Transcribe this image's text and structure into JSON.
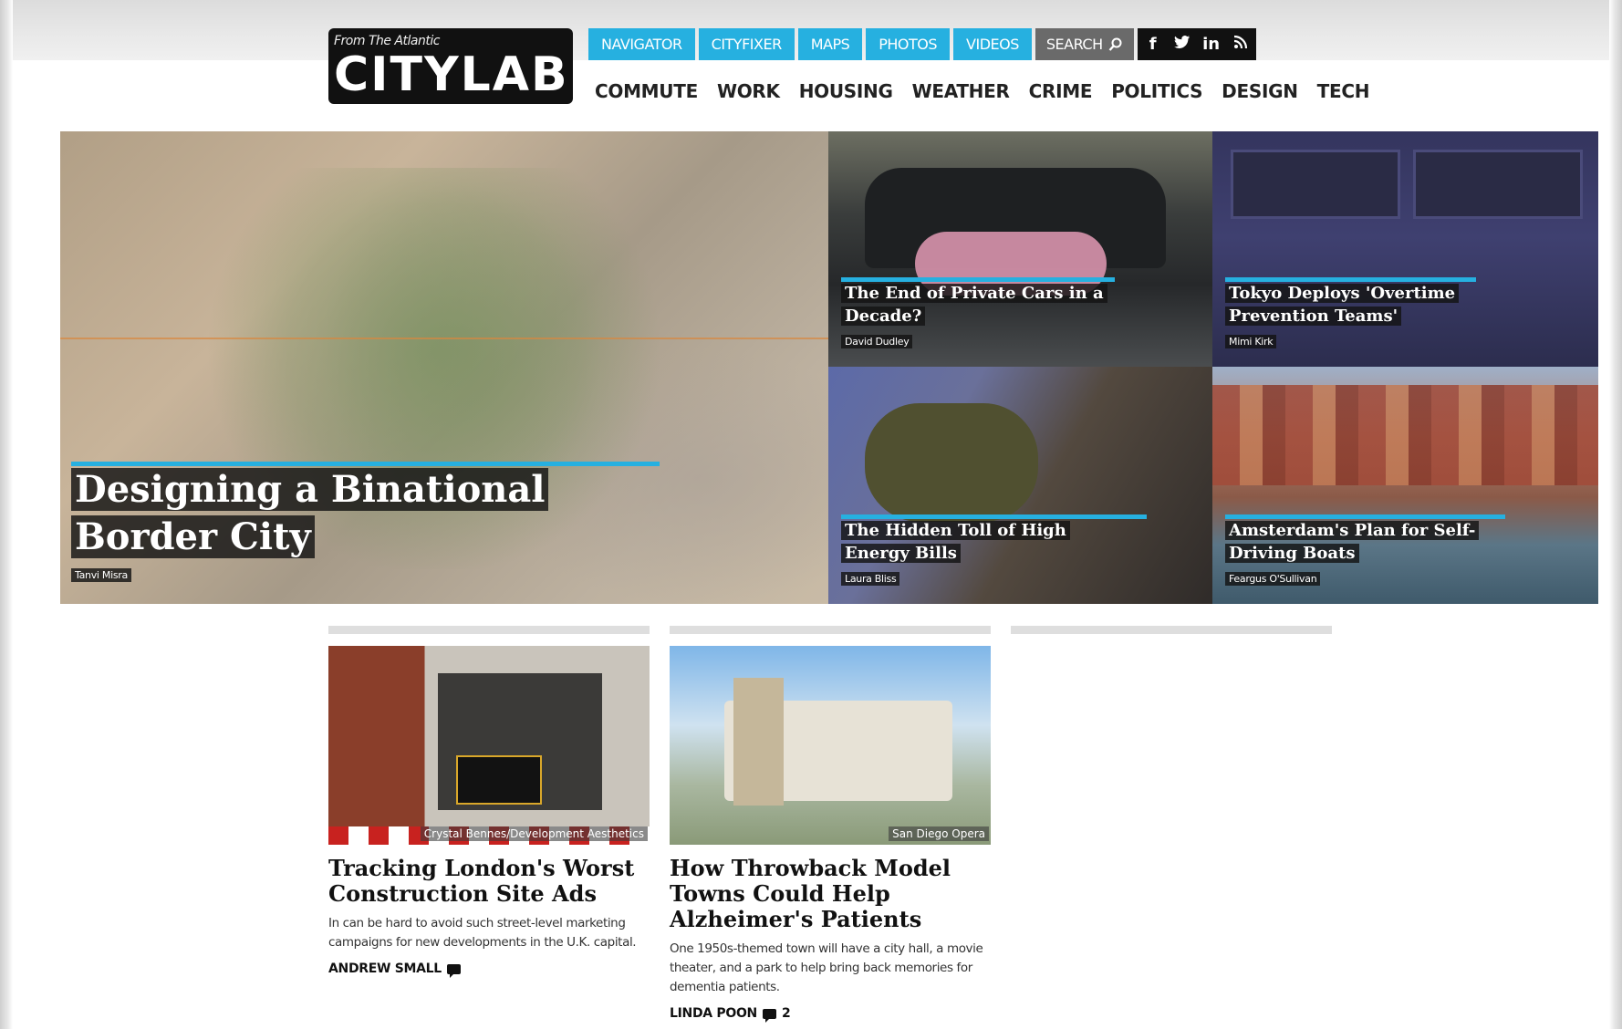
{
  "brand": {
    "from_label": "From The Atlantic",
    "name": "CITYLAB"
  },
  "top_nav": {
    "tabs": [
      "NAVIGATOR",
      "CITYFIXER",
      "MAPS",
      "PHOTOS",
      "VIDEOS"
    ],
    "search_label": "SEARCH",
    "social": [
      "f",
      "t",
      "in",
      "rss"
    ]
  },
  "categories": [
    "COMMUTE",
    "WORK",
    "HOUSING",
    "WEATHER",
    "CRIME",
    "POLITICS",
    "DESIGN",
    "TECH"
  ],
  "hero": {
    "main": {
      "title": "Designing a Binational Border City",
      "author": "Tanvi Misra"
    },
    "tiles": [
      {
        "title": "The End of Private Cars in a Decade?",
        "author": "David Dudley"
      },
      {
        "title": "Tokyo Deploys 'Overtime Prevention Teams'",
        "author": "Mimi Kirk"
      },
      {
        "title": "The Hidden Toll of High Energy Bills",
        "author": "Laura Bliss"
      },
      {
        "title": "Amsterdam's Plan for Self-Driving Boats",
        "author": "Feargus O'Sullivan"
      }
    ]
  },
  "stories": [
    {
      "credit": "Crystal Bennes/Development Aesthetics",
      "headline": "Tracking London's Worst Construction Site Ads",
      "dek": "In can be hard to avoid such street-level marketing campaigns for new developments in the U.K. capital.",
      "author": "ANDREW SMALL",
      "comments": ""
    },
    {
      "credit": "San Diego Opera",
      "headline": "How Throwback Model Towns Could Help Alzheimer's Patients",
      "dek": "One 1950s-themed town will have a city hall, a movie theater, and a park to help bring back memories for dementia patients.",
      "author": "LINDA POON",
      "comments": "2"
    }
  ],
  "colors": {
    "accent": "#26b0e0",
    "search_bg": "#6a6a6a",
    "social_bg": "#111111"
  }
}
